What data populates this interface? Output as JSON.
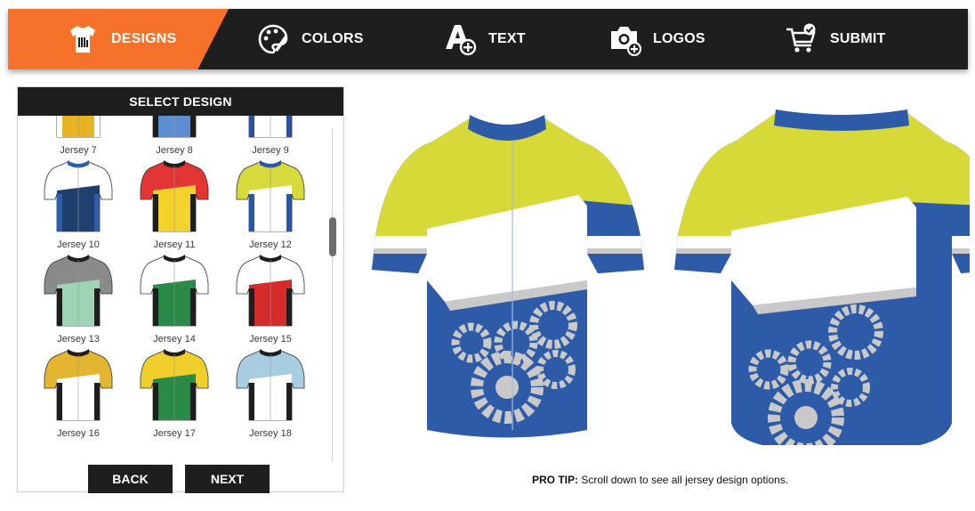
{
  "nav": {
    "items": [
      {
        "label": "DESIGNS",
        "icon": "tshirt-icon",
        "active": true
      },
      {
        "label": "COLORS",
        "icon": "palette-icon",
        "active": false
      },
      {
        "label": "TEXT",
        "icon": "text-add-icon",
        "active": false
      },
      {
        "label": "LOGOS",
        "icon": "camera-add-icon",
        "active": false
      },
      {
        "label": "SUBMIT",
        "icon": "cart-check-icon",
        "active": false
      }
    ],
    "active_color": "#f6722a",
    "bar_color": "#1e1e1e"
  },
  "panel": {
    "title": "SELECT DESIGN",
    "designs": [
      {
        "label": "Jersey 7",
        "colors": [
          "#2a2a2a",
          "#e8b322",
          "#ffffff"
        ]
      },
      {
        "label": "Jersey 8",
        "colors": [
          "#ffffff",
          "#5d8ed1",
          "#1e1e1e"
        ]
      },
      {
        "label": "Jersey 9",
        "colors": [
          "#2d4fa0",
          "#ffffff",
          "#2d4fa0"
        ]
      },
      {
        "label": "Jersey 10",
        "colors": [
          "#ffffff",
          "#1f3f6e",
          "#2d5fa8"
        ]
      },
      {
        "label": "Jersey 11",
        "colors": [
          "#e43535",
          "#f3d22c",
          "#1e1e1e"
        ]
      },
      {
        "label": "Jersey 12",
        "colors": [
          "#d7da3c",
          "#ffffff",
          "#2a55a4"
        ]
      },
      {
        "label": "Jersey 13",
        "colors": [
          "#8a8a8a",
          "#9ed3b5",
          "#1e1e1e"
        ]
      },
      {
        "label": "Jersey 14",
        "colors": [
          "#ffffff",
          "#2a8a48",
          "#1e1e1e"
        ]
      },
      {
        "label": "Jersey 15",
        "colors": [
          "#ffffff",
          "#d62b2b",
          "#1e1e1e"
        ]
      },
      {
        "label": "Jersey 16",
        "colors": [
          "#e3b531",
          "#ffffff",
          "#1e1e1e"
        ]
      },
      {
        "label": "Jersey 17",
        "colors": [
          "#f0cf2c",
          "#2a8a48",
          "#1e1e1e"
        ]
      },
      {
        "label": "Jersey 18",
        "colors": [
          "#a9cde0",
          "#ffffff",
          "#1e1e1e"
        ]
      }
    ],
    "back_label": "BACK",
    "next_label": "NEXT"
  },
  "preview": {
    "colors": {
      "primary": "#d6d937",
      "secondary": "#2d5ba8",
      "stripe": "#ffffff",
      "gears": "#c9c9c9"
    }
  },
  "protip": {
    "label": "PRO TIP:",
    "text": "Scroll down to see all jersey design options."
  }
}
